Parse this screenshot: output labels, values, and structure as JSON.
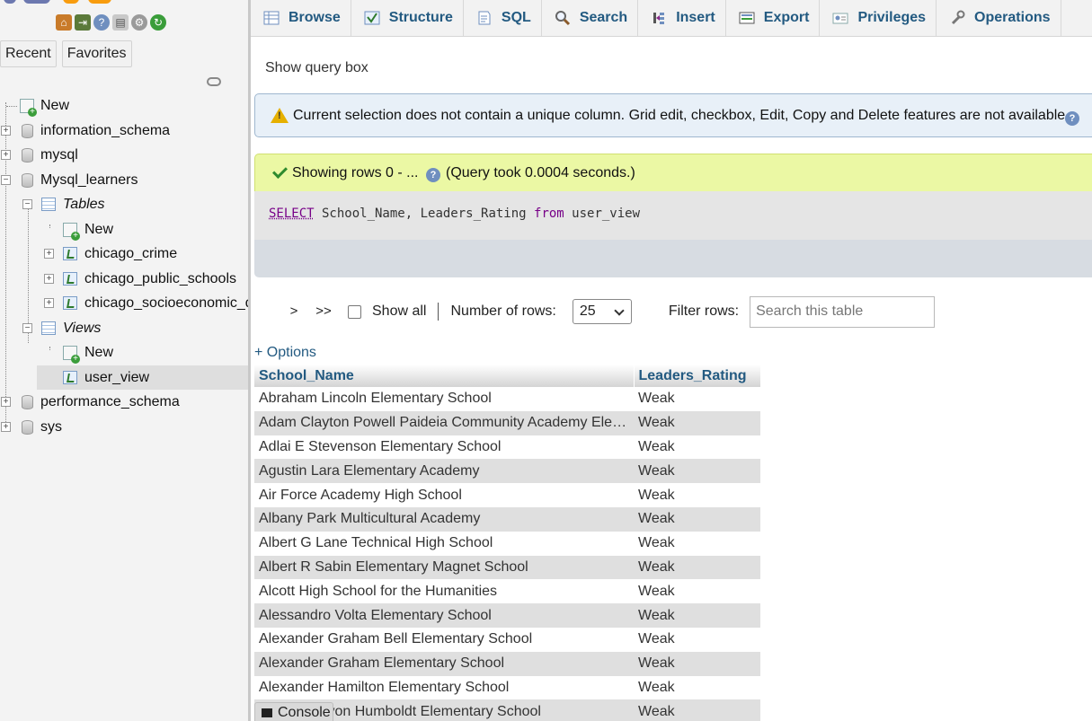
{
  "nav": {
    "recent_label": "Recent",
    "favorites_label": "Favorites",
    "tree": [
      {
        "label": "New",
        "kind": "new"
      },
      {
        "label": "information_schema",
        "kind": "db"
      },
      {
        "label": "mysql",
        "kind": "db"
      },
      {
        "label": "Mysql_learners",
        "kind": "db-open"
      },
      {
        "label": "Tables",
        "kind": "group"
      },
      {
        "label": "New",
        "kind": "new"
      },
      {
        "label": "chicago_crime",
        "kind": "table"
      },
      {
        "label": "chicago_public_schools",
        "kind": "table"
      },
      {
        "label": "chicago_socioeconomic_data",
        "kind": "table"
      },
      {
        "label": "Views",
        "kind": "group"
      },
      {
        "label": "New",
        "kind": "new"
      },
      {
        "label": "user_view",
        "kind": "view",
        "active": true
      },
      {
        "label": "performance_schema",
        "kind": "db"
      },
      {
        "label": "sys",
        "kind": "db"
      }
    ]
  },
  "tabs": [
    {
      "label": "Browse",
      "icon": "browse-icon"
    },
    {
      "label": "Structure",
      "icon": "structure-icon"
    },
    {
      "label": "SQL",
      "icon": "sql-icon"
    },
    {
      "label": "Search",
      "icon": "search-icon"
    },
    {
      "label": "Insert",
      "icon": "insert-icon"
    },
    {
      "label": "Export",
      "icon": "export-icon"
    },
    {
      "label": "Privileges",
      "icon": "privileges-icon"
    },
    {
      "label": "Operations",
      "icon": "operations-icon"
    }
  ],
  "main": {
    "show_query": "Show query box",
    "notice": "Current selection does not contain a unique column. Grid edit, checkbox, Edit, Copy and Delete features are not available.",
    "success": "Showing rows 0 - ...",
    "query_took": "(Query took 0.0004 seconds.)",
    "sql": {
      "kw1": "SELECT",
      "mid": " School_Name, Leaders_Rating ",
      "kw2": "from",
      "tail": " user_view"
    },
    "nav_next": ">",
    "nav_last": ">>",
    "show_all": "Show all",
    "number_of_rows_label": "Number of rows:",
    "number_of_rows_value": "25",
    "filter_label": "Filter rows:",
    "filter_placeholder": "Search this table",
    "options": "+ Options",
    "columns": [
      "School_Name",
      "Leaders_Rating"
    ],
    "rows": [
      [
        "Abraham Lincoln Elementary School",
        "Weak"
      ],
      [
        "Adam Clayton Powell Paideia Community Academy Elementary School",
        "Weak"
      ],
      [
        "Adlai E Stevenson Elementary School",
        "Weak"
      ],
      [
        "Agustin Lara Elementary Academy",
        "Weak"
      ],
      [
        "Air Force Academy High School",
        "Weak"
      ],
      [
        "Albany Park Multicultural Academy",
        "Weak"
      ],
      [
        "Albert G Lane Technical High School",
        "Weak"
      ],
      [
        "Albert R Sabin Elementary Magnet School",
        "Weak"
      ],
      [
        "Alcott High School for the Humanities",
        "Weak"
      ],
      [
        "Alessandro Volta Elementary School",
        "Weak"
      ],
      [
        "Alexander Graham Bell Elementary School",
        "Weak"
      ],
      [
        "Alexander Graham Elementary School",
        "Weak"
      ],
      [
        "Alexander Hamilton Elementary School",
        "Weak"
      ],
      [
        "Alexander von Humboldt Elementary School",
        "Weak"
      ]
    ]
  },
  "console_label": "Console"
}
